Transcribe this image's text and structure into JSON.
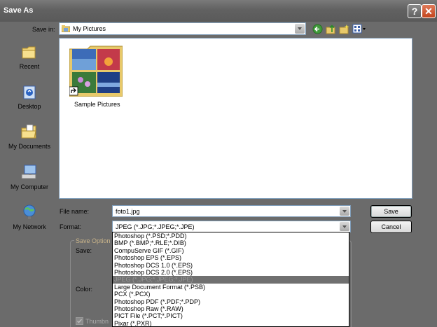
{
  "window": {
    "title": "Save As"
  },
  "toolbar": {
    "save_in_label": "Save in:",
    "save_in_value": "My Pictures"
  },
  "places": [
    {
      "label": "Recent",
      "icon": "recent-folder-icon"
    },
    {
      "label": "Desktop",
      "icon": "desktop-icon"
    },
    {
      "label": "My Documents",
      "icon": "my-documents-icon"
    },
    {
      "label": "My Computer",
      "icon": "my-computer-icon"
    },
    {
      "label": "My Network",
      "icon": "my-network-icon"
    }
  ],
  "files": [
    {
      "label": "Sample Pictures",
      "icon": "folder-shortcut-icon"
    }
  ],
  "form": {
    "file_name_label": "File name:",
    "file_name_value": "foto1.jpg",
    "format_label": "Format:",
    "format_value": "JPEG (*.JPG;*.JPEG;*.JPE)",
    "save_button": "Save",
    "cancel_button": "Cancel"
  },
  "options": {
    "group_label": "Save Option",
    "save_label": "Save:",
    "color_label": "Color:",
    "thumbnail_label": "Thumbn",
    "thumbnail_checked": true
  },
  "format_options": [
    "Photoshop (*.PSD;*.PDD)",
    "BMP (*.BMP;*.RLE;*.DIB)",
    "CompuServe GIF (*.GIF)",
    "Photoshop EPS (*.EPS)",
    "Photoshop DCS 1.0 (*.EPS)",
    "Photoshop DCS 2.0 (*.EPS)",
    "JPEG (*.JPG;*.JPEG;*.JPE)",
    "Large Document Format (*.PSB)",
    "PCX (*.PCX)",
    "Photoshop PDF (*.PDF;*.PDP)",
    "Photoshop Raw (*.RAW)",
    "PICT File (*.PCT;*.PICT)",
    "Pixar (*.PXR)"
  ],
  "selected_format_index": 6,
  "colors": {
    "window_bg": "#6b6b6b",
    "selection": "#707070",
    "selection_text": "#9a9a9a"
  }
}
